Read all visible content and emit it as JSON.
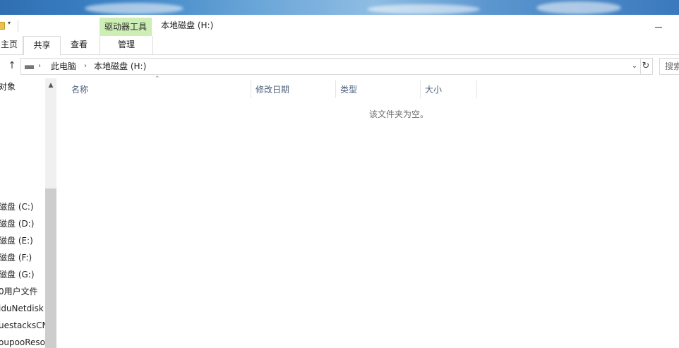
{
  "window": {
    "title": "本地磁盘 (H:)",
    "quick_access_arrow": "▾",
    "context_tab_label": "驱动器工具"
  },
  "ribbon": {
    "tabs": [
      "主页",
      "共享",
      "查看",
      "管理"
    ]
  },
  "address": {
    "up_glyph": "↑",
    "separator": "›",
    "crumbs": [
      "此电脑",
      "本地磁盘 (H:)"
    ],
    "dropdown_glyph": "⌄",
    "refresh_glyph": "↻",
    "search_placeholder": "搜索"
  },
  "nav_pane": {
    "items": [
      "对象",
      "",
      "",
      "",
      "",
      "",
      "",
      "磁盘 (C:)",
      "磁盘 (D:)",
      "磁盘 (E:)",
      "磁盘 (F:)",
      "磁盘 (G:)",
      "0用户文件",
      "iduNetdisk",
      "uestacksCN",
      "oupooReso"
    ]
  },
  "file_list": {
    "columns": [
      "名称",
      "修改日期",
      "类型",
      "大小"
    ],
    "empty_message": "该文件夹为空。"
  },
  "colors": {
    "context_tab_bg": "#cdeeb5",
    "column_header_text": "#4c607a",
    "empty_text": "#6d6d6d"
  }
}
